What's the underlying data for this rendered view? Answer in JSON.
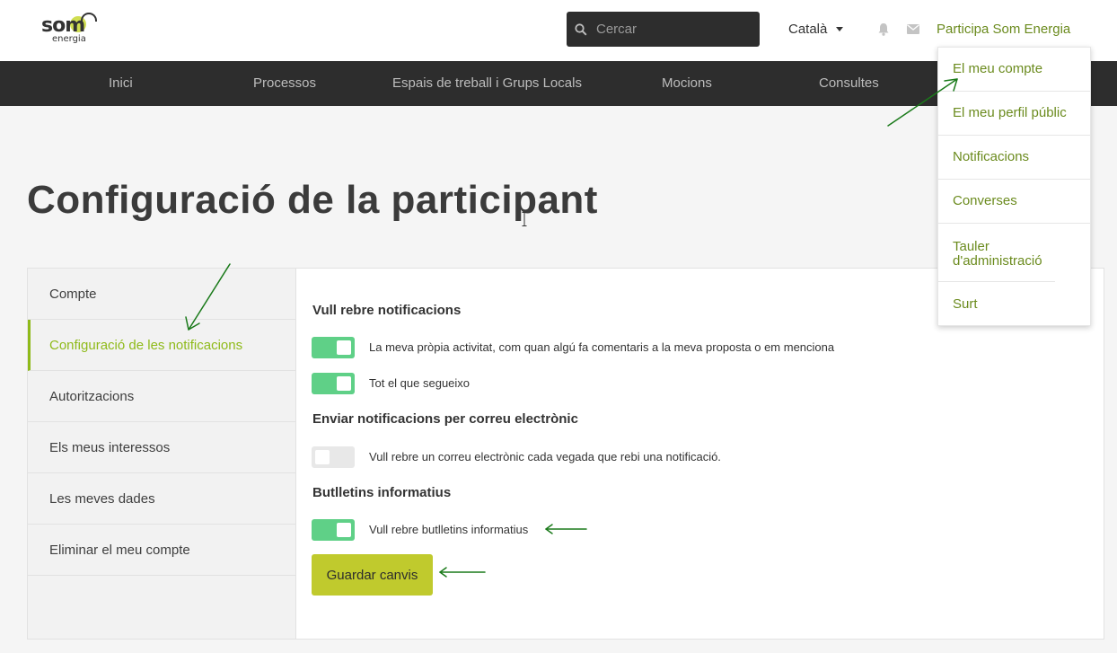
{
  "header": {
    "logo": {
      "main": "som",
      "sub": "energia"
    },
    "search": {
      "placeholder": "Cercar",
      "value": ""
    },
    "language": "Català",
    "user_menu_label": "Participa Som Energia"
  },
  "nav": {
    "items": [
      "Inici",
      "Processos",
      "Espais de treball i Grups Locals",
      "Mocions",
      "Consultes"
    ]
  },
  "page": {
    "title": "Configuració de la participant"
  },
  "sidebar": {
    "items": [
      {
        "label": "Compte",
        "active": false
      },
      {
        "label": "Configuració de les notificacions",
        "active": true
      },
      {
        "label": "Autoritzacions",
        "active": false
      },
      {
        "label": "Els meus interessos",
        "active": false
      },
      {
        "label": "Les meves dades",
        "active": false
      },
      {
        "label": "Eliminar el meu compte",
        "active": false
      }
    ]
  },
  "settings": {
    "sections": [
      {
        "title": "Vull rebre notificacions"
      },
      {
        "title": "Enviar notificacions per correu electrònic"
      },
      {
        "title": "Butlletins informatius"
      }
    ],
    "toggles": [
      {
        "label": "La meva pròpia activitat, com quan algú fa comentaris a la meva proposta o em menciona",
        "on": true
      },
      {
        "label": "Tot el que segueixo",
        "on": true
      },
      {
        "label": "Vull rebre un correu electrònic cada vegada que rebi una notificació.",
        "on": false
      },
      {
        "label": "Vull rebre butlletins informatius",
        "on": true
      }
    ],
    "save_label": "Guardar canvis"
  },
  "user_dropdown": {
    "items": [
      "El meu compte",
      "El meu perfil públic",
      "Notificacions",
      "Converses",
      "Tauler d'administració",
      "Surt"
    ]
  },
  "colors": {
    "accent_green": "#8fba1a",
    "link_green": "#6b8b1e",
    "toggle_on": "#5fd087",
    "button": "#c0ca2d",
    "dark_bar": "#2d2d2d",
    "annotation_arrow": "#1a7a1a"
  }
}
